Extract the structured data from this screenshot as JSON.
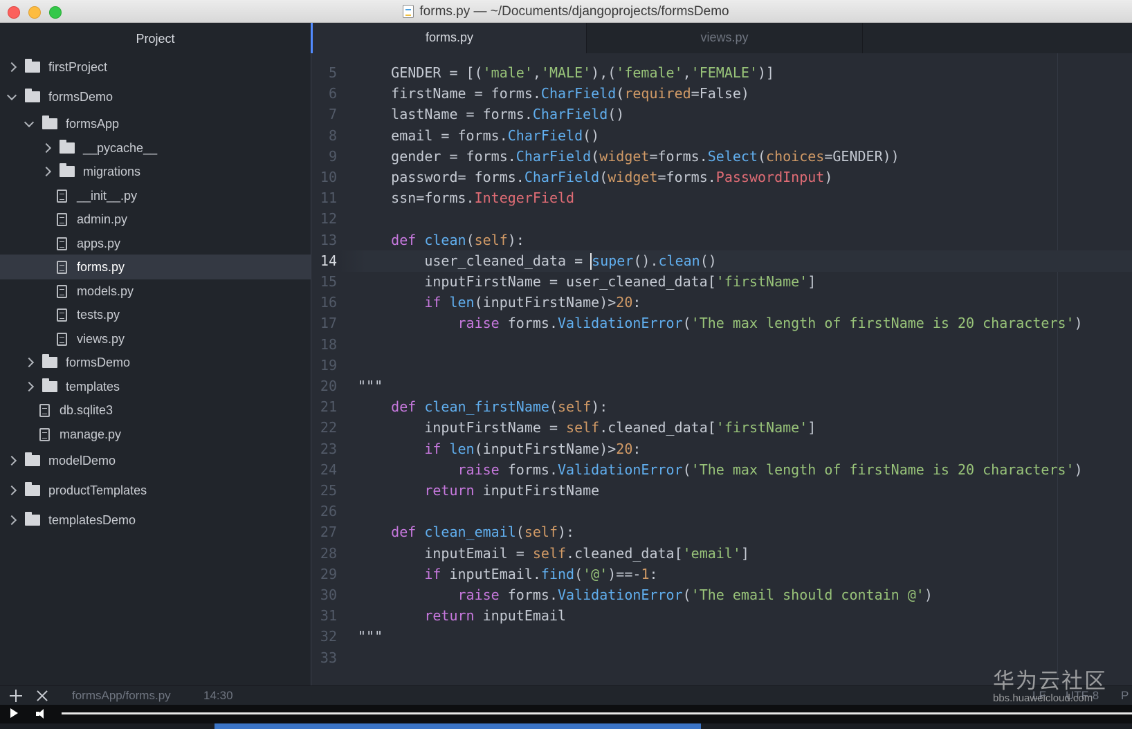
{
  "window": {
    "title": "forms.py — ~/Documents/djangoprojects/formsDemo"
  },
  "sidebar": {
    "header": "Project",
    "items": [
      {
        "label": "firstProject",
        "type": "folder",
        "expanded": false
      },
      {
        "label": "formsDemo",
        "type": "folder",
        "expanded": true
      },
      {
        "label": "formsApp",
        "type": "folder",
        "expanded": true
      },
      {
        "label": "__pycache__",
        "type": "folder",
        "expanded": false
      },
      {
        "label": "migrations",
        "type": "folder",
        "expanded": false
      },
      {
        "label": "__init__.py",
        "type": "file"
      },
      {
        "label": "admin.py",
        "type": "file"
      },
      {
        "label": "apps.py",
        "type": "file"
      },
      {
        "label": "forms.py",
        "type": "file",
        "selected": true
      },
      {
        "label": "models.py",
        "type": "file"
      },
      {
        "label": "tests.py",
        "type": "file"
      },
      {
        "label": "views.py",
        "type": "file"
      },
      {
        "label": "formsDemo",
        "type": "folder",
        "expanded": false
      },
      {
        "label": "templates",
        "type": "folder",
        "expanded": false
      },
      {
        "label": "db.sqlite3",
        "type": "file"
      },
      {
        "label": "manage.py",
        "type": "file"
      },
      {
        "label": "modelDemo",
        "type": "folder",
        "expanded": false
      },
      {
        "label": "productTemplates",
        "type": "folder",
        "expanded": false
      },
      {
        "label": "templatesDemo",
        "type": "folder",
        "expanded": false
      }
    ]
  },
  "tabs": [
    {
      "label": "forms.py",
      "active": true
    },
    {
      "label": "views.py",
      "active": false
    }
  ],
  "editor": {
    "current_line": 14,
    "lines": [
      {
        "n": "5",
        "text": "    GENDER = [('male','MALE'),('female','FEMALE')]"
      },
      {
        "n": "6",
        "text": "    firstName = forms.CharField(required=False)"
      },
      {
        "n": "7",
        "text": "    lastName = forms.CharField()"
      },
      {
        "n": "8",
        "text": "    email = forms.CharField()"
      },
      {
        "n": "9",
        "text": "    gender = forms.CharField(widget=forms.Select(choices=GENDER))"
      },
      {
        "n": "10",
        "text": "    password= forms.CharField(widget=forms.PasswordInput)"
      },
      {
        "n": "11",
        "text": "    ssn=forms.IntegerField"
      },
      {
        "n": "12",
        "text": ""
      },
      {
        "n": "13",
        "text": "    def clean(self):"
      },
      {
        "n": "14",
        "text": "        user_cleaned_data = super().clean()"
      },
      {
        "n": "15",
        "text": "        inputFirstName = user_cleaned_data['firstName']"
      },
      {
        "n": "16",
        "text": "        if len(inputFirstName)>20:"
      },
      {
        "n": "17",
        "text": "            raise forms.ValidationError('The max length of firstName is 20 characters')"
      },
      {
        "n": "18",
        "text": ""
      },
      {
        "n": "19",
        "text": ""
      },
      {
        "n": "20",
        "text": "\"\"\""
      },
      {
        "n": "21",
        "text": "    def clean_firstName(self):"
      },
      {
        "n": "22",
        "text": "        inputFirstName = self.cleaned_data['firstName']"
      },
      {
        "n": "23",
        "text": "        if len(inputFirstName)>20:"
      },
      {
        "n": "24",
        "text": "            raise forms.ValidationError('The max length of firstName is 20 characters')"
      },
      {
        "n": "25",
        "text": "        return inputFirstName"
      },
      {
        "n": "26",
        "text": ""
      },
      {
        "n": "27",
        "text": "    def clean_email(self):"
      },
      {
        "n": "28",
        "text": "        inputEmail = self.cleaned_data['email']"
      },
      {
        "n": "29",
        "text": "        if inputEmail.find('@')==-1:"
      },
      {
        "n": "30",
        "text": "            raise forms.ValidationError('The email should contain @')"
      },
      {
        "n": "31",
        "text": "        return inputEmail"
      },
      {
        "n": "32",
        "text": "\"\"\""
      },
      {
        "n": "33",
        "text": ""
      }
    ]
  },
  "statusbar": {
    "path": "formsApp/forms.py",
    "cursor": "14:30",
    "line_ending": "LF",
    "encoding": "UTF-8",
    "grammar": "P"
  },
  "player": {
    "buffered_fraction": 0.53
  },
  "watermark": {
    "title": "华为云社区",
    "url": "bbs.huaweicloud.com"
  },
  "colors": {
    "keyword": "#c678dd",
    "function": "#61afef",
    "string": "#98c379",
    "parameter": "#d19a66",
    "class": "#e06c75",
    "accent": "#528bff"
  }
}
